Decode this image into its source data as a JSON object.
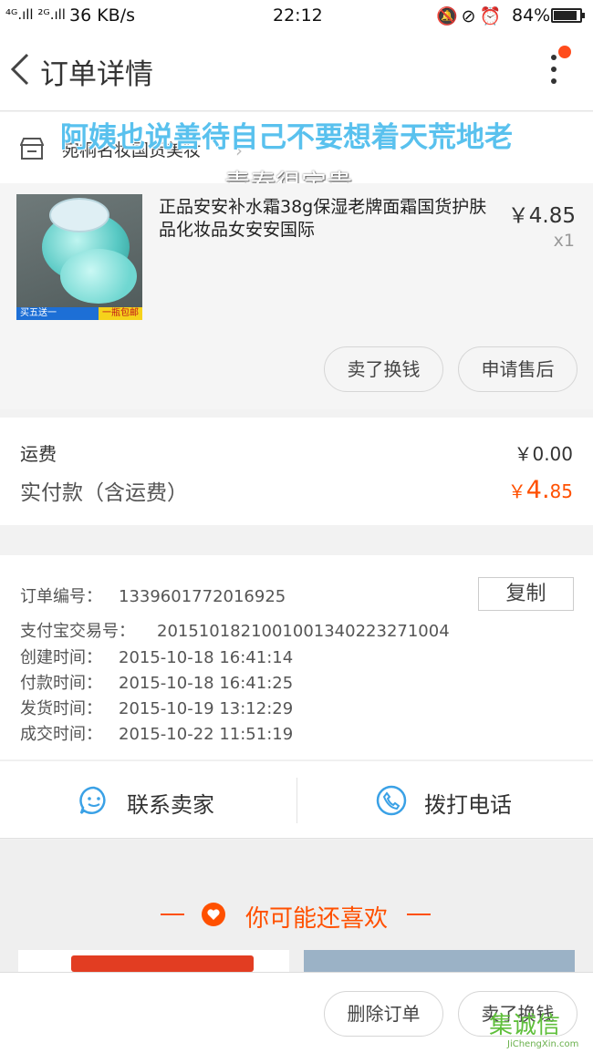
{
  "status_bar": {
    "signal": "⁴ᴳ.ıll ²ᴳ.ıll",
    "speed": "36 KB/s",
    "time": "22:12",
    "battery": "84%"
  },
  "nav": {
    "title": "订单详情"
  },
  "shop": {
    "name": "宛桐名妆国货美妆"
  },
  "overlay": {
    "line1": "阿姨也说善待自己不要想着天荒地老",
    "line2": "青春很宝贵"
  },
  "item": {
    "title": "正品安安补水霜38g保湿老牌面霜国货护肤品化妆品女安安国际",
    "price": "￥4.85",
    "qty": "x1",
    "promo_left": "买五送一",
    "promo_right": "一瓶包邮",
    "buttons": {
      "resell": "卖了换钱",
      "aftersale": "申请售后"
    }
  },
  "fees": {
    "shipping_label": "运费",
    "shipping_value": "￥0.00",
    "paid_label": "实付款（含运费）",
    "paid_currency": "￥",
    "paid_int": "4.",
    "paid_dec": "85"
  },
  "order_info": {
    "order_no_label": "订单编号：",
    "order_no": "1339601772016925",
    "copy_label": "复制",
    "alipay_label": "支付宝交易号：",
    "alipay_no": "2015101821001001340223271004",
    "created_label": "创建时间：",
    "created": "2015-10-18 16:41:14",
    "paid_time_label": "付款时间：",
    "paid_time": "2015-10-18 16:41:25",
    "shipped_label": "发货时间：",
    "shipped": "2015-10-19 13:12:29",
    "closed_label": "成交时间：",
    "closed": "2015-10-22 11:51:19"
  },
  "contact": {
    "seller": "联系卖家",
    "call": "拨打电话"
  },
  "recommend": {
    "title": "你可能还喜欢"
  },
  "bottom": {
    "delete": "删除订单",
    "resell": "卖了换钱"
  },
  "watermark": {
    "text": "集诚信",
    "sub": "JiChengXin.com"
  },
  "colors": {
    "accent": "#ff5000",
    "blue": "#3aa1e6",
    "overlay_blue": "#59c1ee"
  }
}
